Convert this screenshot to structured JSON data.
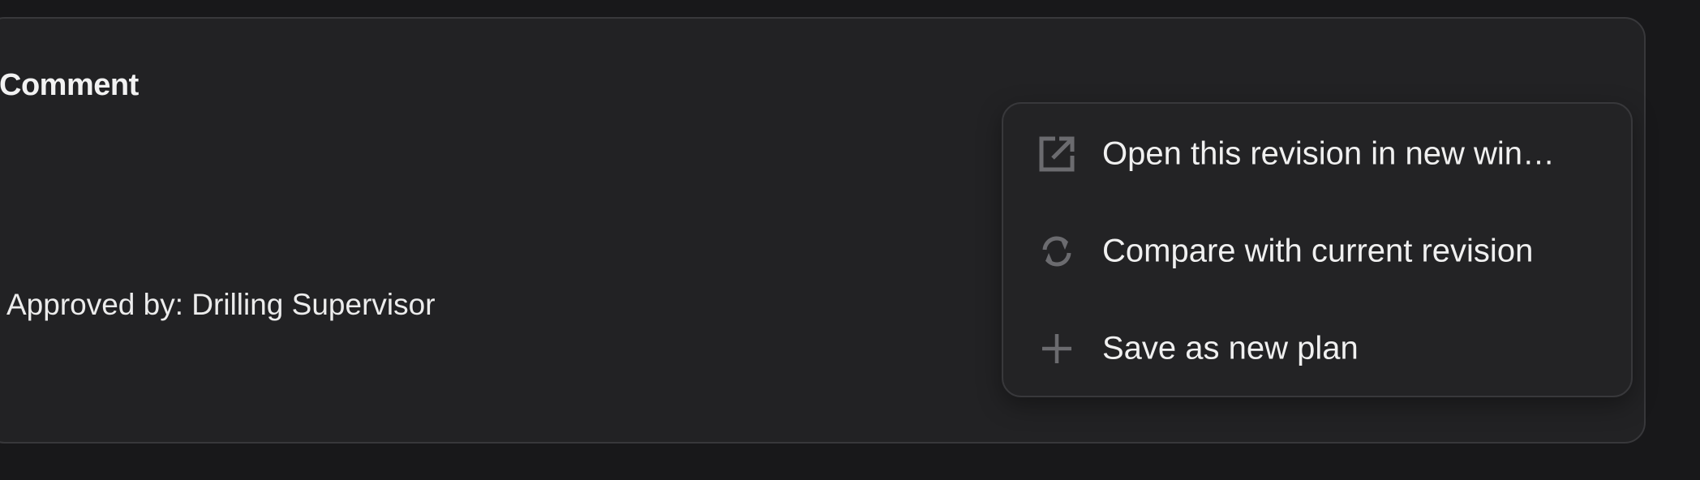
{
  "panel": {
    "title": "Comment",
    "comment": "Approved by: Drilling Supervisor"
  },
  "context_menu": {
    "items": [
      {
        "label": "Open this revision in new win…",
        "icon": "open-in-new-window-icon"
      },
      {
        "label": "Compare with current revision",
        "icon": "sync-compare-icon"
      },
      {
        "label": "Save as new plan",
        "icon": "plus-icon"
      }
    ]
  },
  "colors": {
    "background": "#18181a",
    "panel": "#222224",
    "menu": "#232325",
    "border": "#38383b",
    "text": "#f0f0f0",
    "icon": "#6b6b6f"
  }
}
